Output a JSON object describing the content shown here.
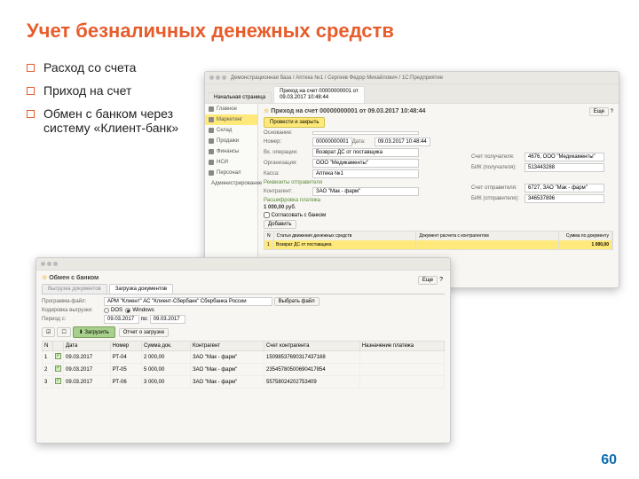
{
  "slide": {
    "title": "Учет безналичных денежных средств",
    "bullets": [
      "Расход со счета",
      "Приход на счет",
      "Обмен с банком через систему «Клиент-банк»"
    ],
    "page_num": "60"
  },
  "win1": {
    "titlebar": "Демонстрационная база / Аптека №1 / Сергеев Федор Михайлович / 1С:Предприятие",
    "tab_home": "Начальная страница",
    "tab_active_line1": "Приход на счет 00000000001 от",
    "tab_active_line2": "09.03.2017 10:48:44",
    "sidebar": [
      "Главное",
      "Маркетинг",
      "Склад",
      "Продажи",
      "Финансы",
      "НСИ",
      "Персонал",
      "Администрирование"
    ],
    "doc_title": "Приход на счет 00000000001 от 09.03.2017 10:48:44",
    "btn_main": "Провести и закрыть",
    "esc_label": "Еще",
    "f_reason_lbl": "Основание:",
    "f_num_lbl": "Номер:",
    "f_num_val": "00000000001",
    "f_date_lbl": "Дата:",
    "f_date_val": "09.03.2017 10:48:44",
    "f_op_lbl": "Вх. операции:",
    "f_op_val": "Возврат ДС от поставщика",
    "f_org_lbl": "Организация:",
    "f_org_val": "ООО \"Медикаменты\"",
    "f_cash_lbl": "Касса:",
    "f_cash_val": "Аптека №1",
    "sec1": "Реквизиты отправителя",
    "f_contr_lbl": "Контрагент:",
    "f_contr_val": "ЗАО \"Мак - фарм\"",
    "sec2": "Расшифровка платежа",
    "sum_total": "1 000,00",
    "sum_cur": "руб.",
    "checkbox_lbl": "Согласовать с банком",
    "btn_add": "Добавить",
    "grid_headers": [
      "N",
      "Статья движения денежных средств",
      "Документ расчета с контрагентом",
      "Сумма по документу"
    ],
    "grid_row": [
      "1",
      "Возврат ДС от поставщика",
      "",
      "1 000,00"
    ],
    "r_acc_lbl": "Счет получателя:",
    "r_acc_val": "4676, ООО \"Медикаменты\"",
    "r_bik_lbl": "БИК (получателя):",
    "r_bik_val": "513443288",
    "r_acc2_lbl": "Счет отправителя:",
    "r_acc2_val": "6727, ЗАО \"Мак - фарм\"",
    "r_bik2_lbl": "БИК (отправителя):",
    "r_bik2_val": "346537896"
  },
  "win2": {
    "doc_title": "Обмен с банком",
    "tab_a": "Выгрузка документов",
    "tab_b": "Загрузка документов",
    "f_prog_lbl": "Программа-файл:",
    "f_prog_val": "АРМ \"Клиент\" АС \"Клиент-Сбербанк\" Сбербанка России",
    "btn_file": "Выбрать файл",
    "f_enc_lbl": "Кодировка выгрузки:",
    "enc_dos": "DOS",
    "enc_win": "Windows",
    "f_period_lbl": "Период с:",
    "f_period_from": "09.03.2017",
    "f_period_to_lbl": "по:",
    "f_period_to": "09.03.2017",
    "btn_load": "Загрузить",
    "btn_report": "Отчет о загрузке",
    "esc_label": "Еще",
    "headers": [
      "N",
      "",
      "Дата",
      "Номер",
      "Сумма док.",
      "Контрагент",
      "Счет контрагента",
      "Назначение платежа"
    ],
    "rows": [
      {
        "n": "1",
        "date": "09.03.2017",
        "num": "РТ-04",
        "sum": "2 000,00",
        "contr": "ЗАО \"Мак - фарм\"",
        "acc": "15098537690317437168"
      },
      {
        "n": "2",
        "date": "09.03.2017",
        "num": "РТ-05",
        "sum": "5 000,00",
        "contr": "ЗАО \"Мак - фарм\"",
        "acc": "23545780500690417854"
      },
      {
        "n": "3",
        "date": "09.03.2017",
        "num": "РТ-06",
        "sum": "3 000,00",
        "contr": "ЗАО \"Мак - фарм\"",
        "acc": "55758024202753409"
      }
    ]
  }
}
